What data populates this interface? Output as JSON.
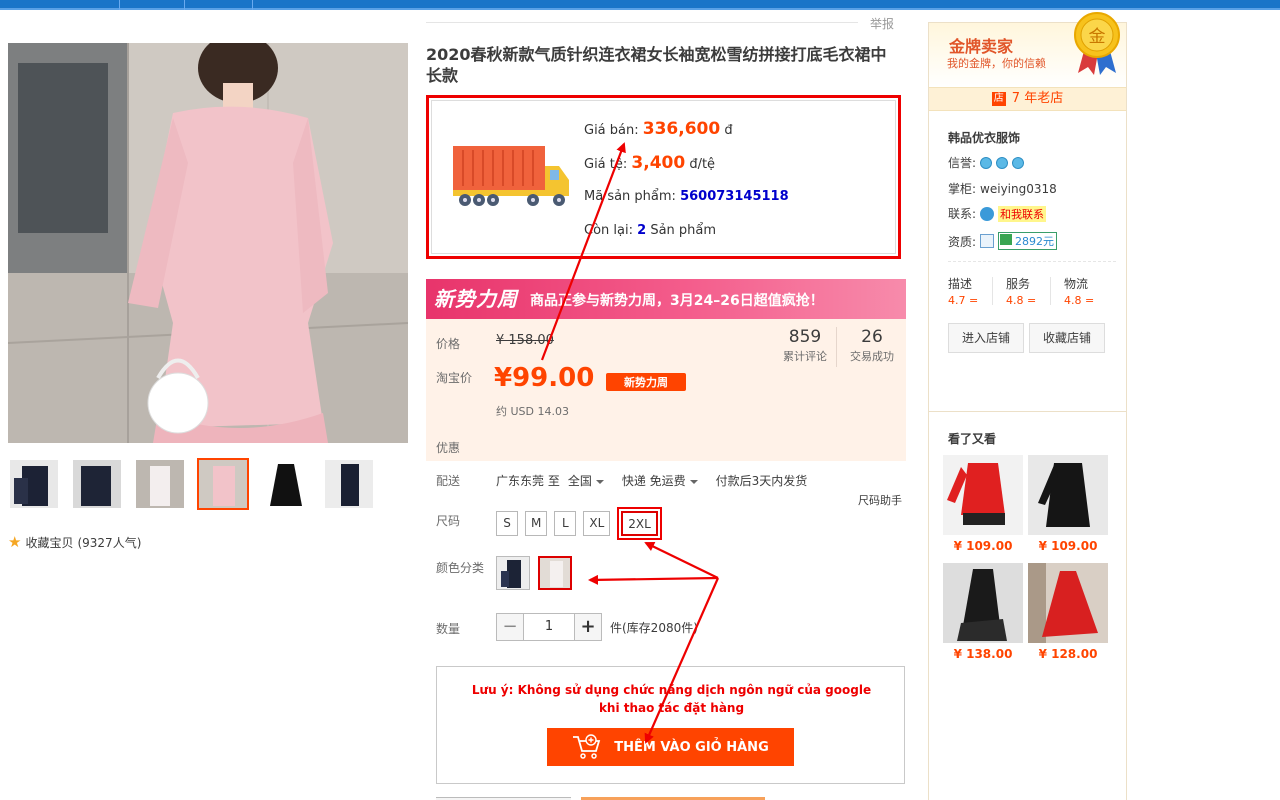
{
  "report_label": "举报",
  "title": "2020春秋新款气质针织连衣裙女长袖宽松雪纺拼接打底毛衣裙中长款",
  "info_box": {
    "sell_label": "Giá bán:",
    "sell_value": "336,600",
    "sell_unit": "đ",
    "rate_label": "Giá tệ:",
    "rate_value": "3,400",
    "rate_unit": "đ/tệ",
    "code_label": "Mã sản phẩm:",
    "code_value": "560073145118",
    "remain_label": "Còn lại:",
    "remain_value": "2",
    "remain_unit": "Sản phẩm"
  },
  "promo": {
    "logo": "新势力周",
    "text": "商品正参与新势力周，3月24–26日超值疯抢！"
  },
  "price": {
    "price_label": "价格",
    "original": "¥ 158.00",
    "taobao_label": "淘宝价",
    "current": "¥99.00",
    "tag": "新势力周",
    "usd": "约 USD 14.03",
    "discount_label": "优惠",
    "reviews_count": "859",
    "reviews_label": "累计评论",
    "deals_count": "26",
    "deals_label": "交易成功"
  },
  "delivery": {
    "label": "配送",
    "from": "广东东莞 至",
    "to": "全国",
    "express": "快递 免运费",
    "ship": "付款后3天内发货",
    "size_help": "尺码助手"
  },
  "size": {
    "label": "尺码",
    "options": [
      "S",
      "M",
      "L",
      "XL",
      "2XL"
    ],
    "selected": "2XL"
  },
  "color": {
    "label": "颜色分类",
    "selected_index": 1
  },
  "quantity": {
    "label": "数量",
    "minus": "−",
    "value": "1",
    "plus": "+",
    "stock": "件(库存2080件)"
  },
  "cart": {
    "warning_line1": "Lưu ý: Không sử dụng chức năng dịch ngôn ngữ của google",
    "warning_line2": "khi thao tác đặt hàng",
    "add_button": "THÊM VÀO GIỎ HÀNG"
  },
  "gallery": {
    "selected_thumb": 3,
    "favorite_label": "收藏宝贝",
    "favorite_count": "(9327人气)"
  },
  "shop": {
    "gold_title": "金牌卖家",
    "gold_sub": "我的金牌，你的信赖",
    "medal_char": "金",
    "old_icon": "店",
    "old_label": "7 年老店",
    "name": "韩品优衣服饰",
    "credit_label": "信誉:",
    "keeper_label": "掌柜:",
    "keeper_value": "weiying0318",
    "contact_label": "联系:",
    "contact_value": "和我联系",
    "qual_label": "资质:",
    "qual_value": "2892元",
    "dsr": [
      {
        "k": "描述",
        "v": "4.7 ="
      },
      {
        "k": "服务",
        "v": "4.8 ="
      },
      {
        "k": "物流",
        "v": "4.8 ="
      }
    ],
    "enter_button": "进入店铺",
    "collect_button": "收藏店铺"
  },
  "see_also": {
    "title": "看了又看",
    "items": [
      {
        "price": "¥ 109.00"
      },
      {
        "price": "¥ 109.00"
      },
      {
        "price": "¥ 138.00"
      },
      {
        "price": "¥ 128.00"
      }
    ]
  },
  "colors": {
    "accent": "#ff4400",
    "annotation_red": "#e00000",
    "promo_pink": "#e8346b",
    "top_bar": "#1a74c8",
    "price_panel_bg": "#fff2e8"
  }
}
